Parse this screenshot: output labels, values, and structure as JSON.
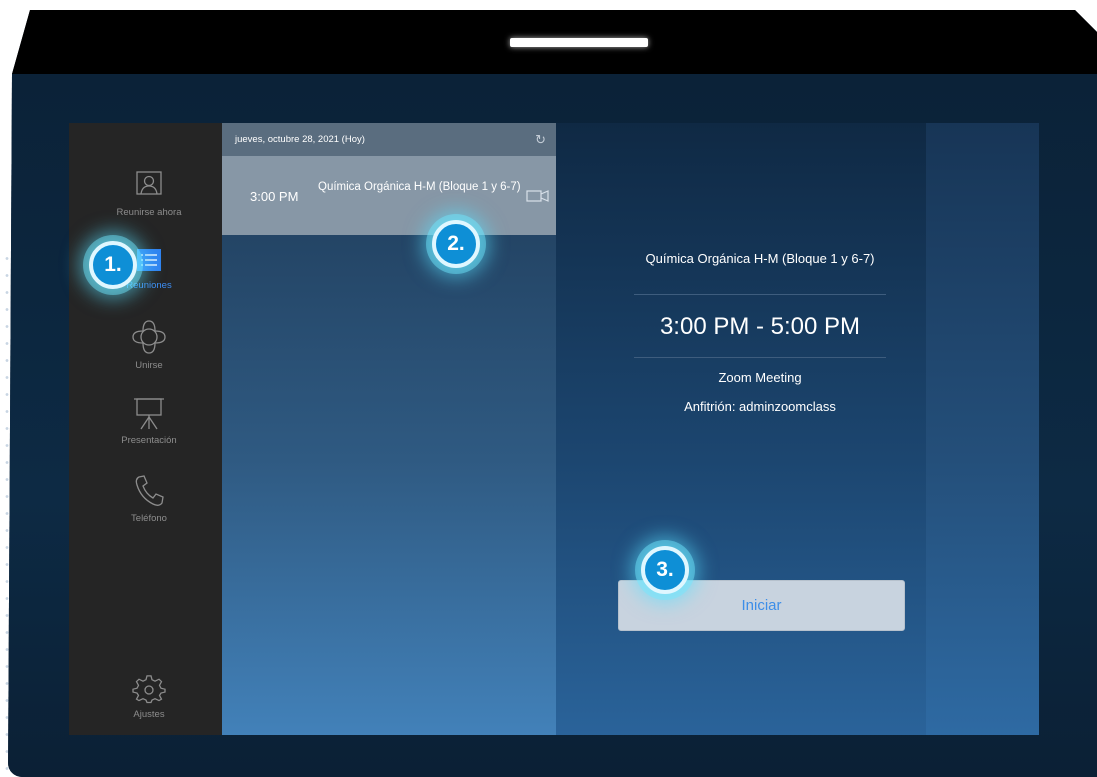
{
  "sidebar": {
    "items": [
      {
        "label": "Reunirse ahora",
        "icon": "contact-icon"
      },
      {
        "label": "Reuniones",
        "icon": "list-icon",
        "active": true
      },
      {
        "label": "Unirse",
        "icon": "flower-icon"
      },
      {
        "label": "Presentación",
        "icon": "projector-icon"
      },
      {
        "label": "Teléfono",
        "icon": "phone-icon"
      }
    ],
    "settings_label": "Ajustes"
  },
  "list": {
    "date": "jueves, octubre 28, 2021 (Hoy)",
    "meetings": [
      {
        "time": "3:00 PM",
        "title": "Química Orgánica H-M (Bloque 1 y 6-7)"
      }
    ]
  },
  "detail": {
    "title": "Química Orgánica H-M (Bloque 1 y 6-7)",
    "time_range": "3:00 PM - 5:00 PM",
    "meeting_type": "Zoom Meeting",
    "host": "Anfitrión: adminzoomclass",
    "start_label": "Iniciar"
  },
  "steps": [
    "1.",
    "2.",
    "3."
  ],
  "colors": {
    "accent": "#3d8ef2",
    "sidebar_bg": "#252525",
    "badge": "#0e8fd6"
  }
}
